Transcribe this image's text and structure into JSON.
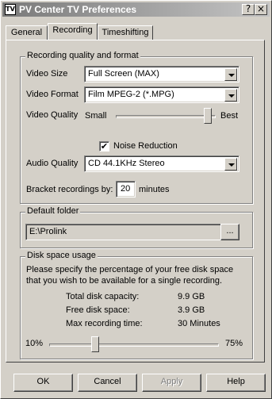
{
  "window": {
    "title": "PV Center TV Preferences",
    "icon_text": "TV"
  },
  "tabs": [
    {
      "label": "General"
    },
    {
      "label": "Recording"
    },
    {
      "label": "Timeshifting"
    }
  ],
  "quality": {
    "legend": "Recording quality and format",
    "video_size_label": "Video Size",
    "video_size_value": "Full Screen (MAX)",
    "video_format_label": "Video Format",
    "video_format_value": "Film MPEG-2 (*.MPG)",
    "video_quality_label": "Video Quality",
    "slider_min": "Small",
    "slider_max": "Best",
    "video_quality_level": 0.96,
    "noise_reduction_label": "Noise Reduction",
    "noise_reduction_checked": true,
    "audio_quality_label": "Audio Quality",
    "audio_quality_value": "CD 44.1KHz Stereo",
    "bracket_label": "Bracket recordings by:",
    "bracket_value": "20",
    "bracket_unit": "minutes"
  },
  "folder": {
    "legend": "Default folder",
    "path": "E:\\Prolink",
    "browse_label": "..."
  },
  "disk": {
    "legend": "Disk space usage",
    "description_line1": "Please specify the percentage of your free disk space",
    "description_line2": "that you wish to be available for a single recording.",
    "total_label": "Total disk capacity:",
    "total_value": "9.9 GB",
    "free_label": "Free disk space:",
    "free_value": "3.9 GB",
    "max_label": "Max recording time:",
    "max_value": "30 Minutes",
    "slider_min": "10%",
    "slider_max": "75%",
    "slider_level": 0.26
  },
  "buttons": {
    "ok": "OK",
    "cancel": "Cancel",
    "apply": "Apply",
    "help": "Help"
  }
}
